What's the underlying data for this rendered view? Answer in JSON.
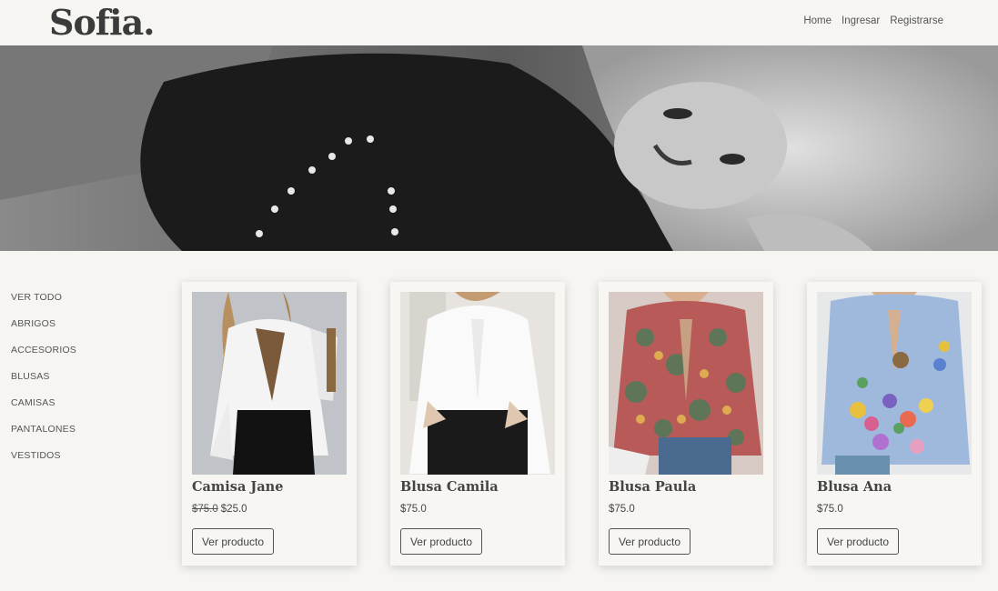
{
  "brand": "Sofia.",
  "nav": {
    "home": "Home",
    "login": "Ingresar",
    "register": "Registrarse"
  },
  "categories": [
    "VER TODO",
    "ABRIGOS",
    "ACCESORIOS",
    "BLUSAS",
    "CAMISAS",
    "PANTALONES",
    "VESTIDOS"
  ],
  "products": [
    {
      "name": "Camisa Jane",
      "old_price": "$75.0",
      "price": "$25.0",
      "button": "Ver producto"
    },
    {
      "name": "Blusa Camila",
      "old_price": "",
      "price": "$75.0",
      "button": "Ver producto"
    },
    {
      "name": "Blusa Paula",
      "old_price": "",
      "price": "$75.0",
      "button": "Ver producto"
    },
    {
      "name": "Blusa Ana",
      "old_price": "",
      "price": "$75.0",
      "button": "Ver producto"
    }
  ]
}
